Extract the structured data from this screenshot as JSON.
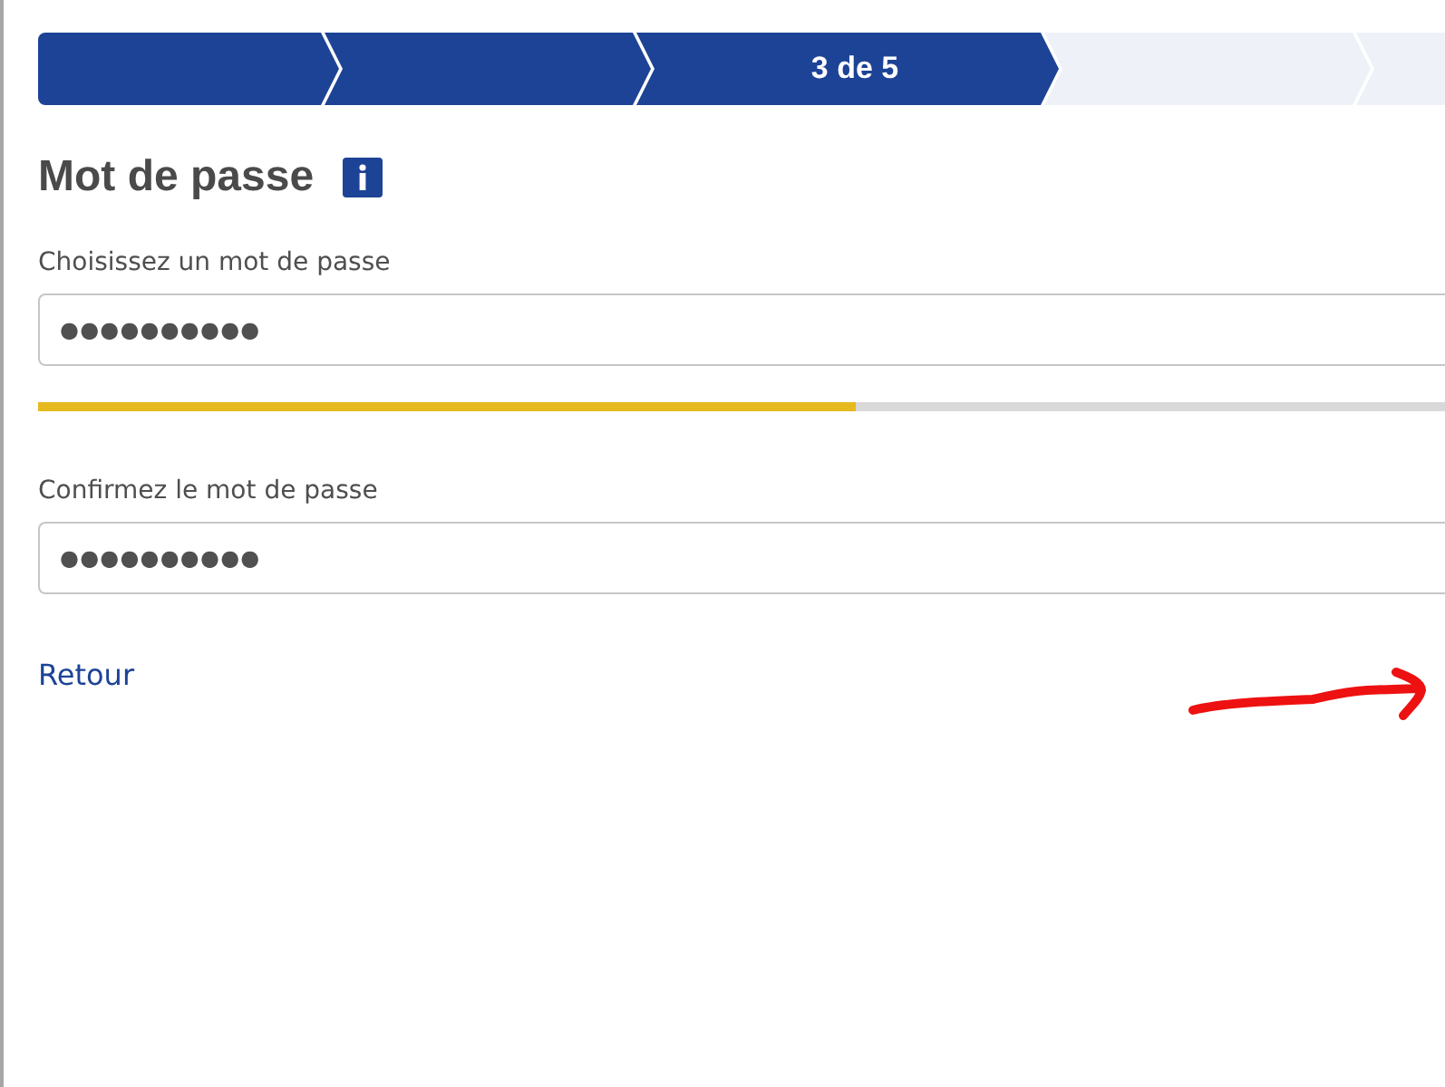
{
  "progress_steps": [
    {
      "reached": true
    },
    {
      "reached": true
    },
    {
      "reached": true,
      "label": "3 de 5"
    },
    {
      "reached": false
    },
    {
      "reached": false
    }
  ],
  "heading": {
    "title": "Mot de passe"
  },
  "password_field": {
    "label": "Choisissez un mot de passe",
    "value": "●●●●●●●●●●"
  },
  "strength_meter": {
    "level": 0.58
  },
  "confirm_field": {
    "label": "Confirmez le mot de passe",
    "value": "●●●●●●●●●●"
  },
  "back_link": {
    "label": "Retour"
  }
}
